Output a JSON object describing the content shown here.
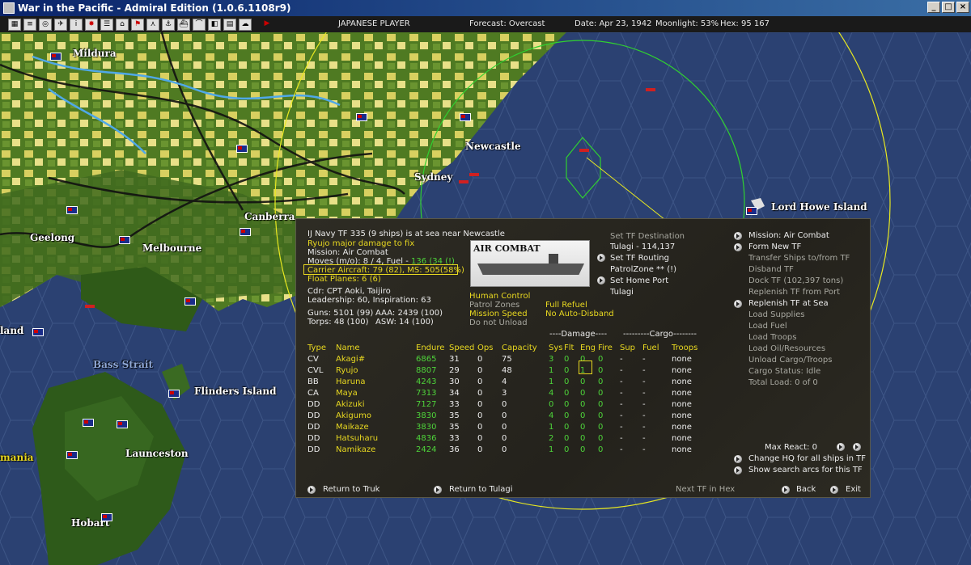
{
  "window": {
    "title": "War in the Pacific - Admiral Edition (1.0.6.1108r9)"
  },
  "toolbar": {
    "buttons": [
      "map-icon",
      "report-icon",
      "ship-icon",
      "plane-icon",
      "info-icon",
      "rising-sun-icon",
      "list-icon",
      "base-icon",
      "flag-icon",
      "air-icon",
      "anchor-icon",
      "fleet-icon",
      "sub-icon",
      "op-icon",
      "grid-icon",
      "cloud-icon",
      "end-turn-icon"
    ],
    "player": "JAPANESE PLAYER",
    "forecast": "Forecast: Overcast",
    "date": "Date: Apr 23, 1942",
    "moonlight": "Moonlight: 53%",
    "hex": "Hex: 95 167"
  },
  "map": {
    "labels": [
      {
        "id": "mildura",
        "text": "Mildura"
      },
      {
        "id": "newcastle",
        "text": "Newcastle"
      },
      {
        "id": "sydney",
        "text": "Sydney"
      },
      {
        "id": "canberra",
        "text": "Canberra"
      },
      {
        "id": "geelong",
        "text": "Geelong"
      },
      {
        "id": "melbourne",
        "text": "Melbourne"
      },
      {
        "id": "lord-howe",
        "text": "Lord Howe Island"
      },
      {
        "id": "land",
        "text": "land"
      },
      {
        "id": "bass-strait",
        "text": "Bass Strait"
      },
      {
        "id": "flinders",
        "text": "Flinders Island"
      },
      {
        "id": "launceston",
        "text": "Launceston"
      },
      {
        "id": "mania",
        "text": "mania"
      },
      {
        "id": "hobart",
        "text": "Hobart"
      }
    ]
  },
  "panel": {
    "header": "IJ Navy TF 335 (9 ships) is at sea near Newcastle",
    "damage_note": "Ryujo major damage to fix",
    "mission": "Mission: Air Combat",
    "moves_prefix": "Moves (m/o): 8 / 4, Fuel - ",
    "fuel_value": "136 (34 (!)",
    "carrier_aircraft": "Carrier Aircraft: 79 (82), MS: 505(58%)",
    "float_planes": "Float Planes: 6 (6)",
    "commander": "Cdr: CPT Aoki, Taijiro",
    "leadership": "Leadership: 60, Inspiration: 63",
    "guns": "Guns: 5101 (99)",
    "aaa": "AAA: 2439 (100)",
    "torps": "Torps: 48 (100)",
    "asw": "ASW: 14 (100)",
    "image_label": "AIR COMBAT",
    "control": {
      "human": "Human Control",
      "patrol": "Patrol Zones",
      "speed": "Mission Speed",
      "unload": "Do not Unload",
      "refuel": "Full Refuel",
      "disband": "No Auto-Disband"
    },
    "destination": {
      "set_dest": "Set TF Destination",
      "dest_value": "Tulagi - 114,137",
      "set_routing": "Set TF Routing",
      "patrol_zone": "PatrolZone ** (!)",
      "set_home": "Set Home Port",
      "home_value": "Tulagi"
    },
    "right_menu": {
      "mission": "Mission: Air Combat",
      "form_new": "Form New TF",
      "transfer": "Transfer Ships to/from TF",
      "disband": "Disband TF",
      "dock": "Dock TF (102,397 tons)",
      "replenish_port": "Replenish TF from Port",
      "replenish_sea": "Replenish TF at Sea",
      "load_supplies": "Load Supplies",
      "load_fuel": "Load Fuel",
      "load_troops": "Load Troops",
      "load_oil": "Load Oil/Resources",
      "unload": "Unload Cargo/Troops",
      "cargo_status": "Cargo Status: Idle",
      "total_load": "Total Load: 0 of 0"
    },
    "group_headers": {
      "damage": "----Damage----",
      "cargo": "---------Cargo--------"
    },
    "columns": [
      "Type",
      "Name",
      "Endure",
      "Speed",
      "Ops",
      "Capacity",
      "Sys",
      "Flt",
      "Eng",
      "Fire",
      "Sup",
      "Fuel",
      "Troops"
    ],
    "ships": [
      {
        "type": "CV",
        "name": "Akagi#",
        "endure": "6865",
        "speed": "31",
        "ops": "0",
        "cap": "75",
        "sys": "3",
        "flt": "0",
        "eng": "0",
        "fire": "0",
        "sup": "-",
        "fuel": "-",
        "troops": "none"
      },
      {
        "type": "CVL",
        "name": "Ryujo",
        "endure": "8807",
        "speed": "29",
        "ops": "0",
        "cap": "48",
        "sys": "1",
        "flt": "0",
        "eng": "1",
        "fire": "0",
        "sup": "-",
        "fuel": "-",
        "troops": "none"
      },
      {
        "type": "BB",
        "name": "Haruna",
        "endure": "4243",
        "speed": "30",
        "ops": "0",
        "cap": "4",
        "sys": "1",
        "flt": "0",
        "eng": "0",
        "fire": "0",
        "sup": "-",
        "fuel": "-",
        "troops": "none"
      },
      {
        "type": "CA",
        "name": "Maya",
        "endure": "7313",
        "speed": "34",
        "ops": "0",
        "cap": "3",
        "sys": "4",
        "flt": "0",
        "eng": "0",
        "fire": "0",
        "sup": "-",
        "fuel": "-",
        "troops": "none"
      },
      {
        "type": "DD",
        "name": "Akizuki",
        "endure": "7127",
        "speed": "33",
        "ops": "0",
        "cap": "0",
        "sys": "0",
        "flt": "0",
        "eng": "0",
        "fire": "0",
        "sup": "-",
        "fuel": "-",
        "troops": "none"
      },
      {
        "type": "DD",
        "name": "Akigumo",
        "endure": "3830",
        "speed": "35",
        "ops": "0",
        "cap": "0",
        "sys": "4",
        "flt": "0",
        "eng": "0",
        "fire": "0",
        "sup": "-",
        "fuel": "-",
        "troops": "none"
      },
      {
        "type": "DD",
        "name": "Maikaze",
        "endure": "3830",
        "speed": "35",
        "ops": "0",
        "cap": "0",
        "sys": "1",
        "flt": "0",
        "eng": "0",
        "fire": "0",
        "sup": "-",
        "fuel": "-",
        "troops": "none"
      },
      {
        "type": "DD",
        "name": "Hatsuharu",
        "endure": "4836",
        "speed": "33",
        "ops": "0",
        "cap": "0",
        "sys": "2",
        "flt": "0",
        "eng": "0",
        "fire": "0",
        "sup": "-",
        "fuel": "-",
        "troops": "none"
      },
      {
        "type": "DD",
        "name": "Namikaze",
        "endure": "2424",
        "speed": "36",
        "ops": "0",
        "cap": "0",
        "sys": "1",
        "flt": "0",
        "eng": "0",
        "fire": "0",
        "sup": "-",
        "fuel": "-",
        "troops": "none"
      }
    ],
    "max_react": "Max React: 0",
    "change_hq": "Change HQ for all ships in TF",
    "show_arcs": "Show search arcs for this TF",
    "bottom": {
      "return_truk": "Return to Truk",
      "return_tulagi": "Return to Tulagi",
      "next_tf": "Next TF in Hex",
      "back": "Back",
      "exit": "Exit"
    }
  }
}
